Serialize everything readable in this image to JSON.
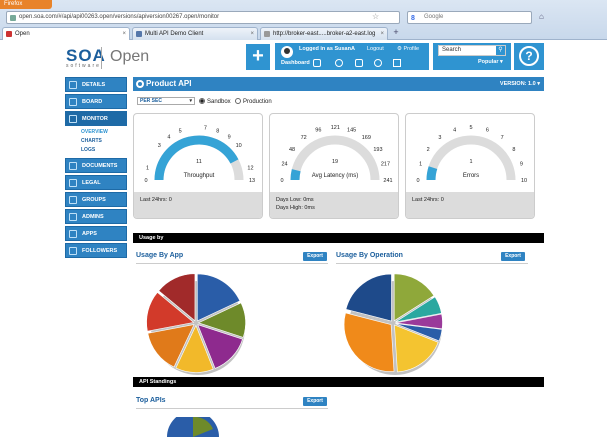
{
  "browser": {
    "menu_label": "Firefox",
    "url": "open.soa.com/#/api/api00263.open/versions/apiversion00267.open/monitor",
    "search_placeholder": "Google",
    "tabs": [
      {
        "label": "Open"
      },
      {
        "label": "Multi API Demo Client"
      },
      {
        "label": "http://broker-east.....broker-a2-east.log"
      }
    ]
  },
  "brand": {
    "name": "SOA",
    "sub": "software",
    "product": "Open"
  },
  "header": {
    "logged_in": "Logged in as SusanA",
    "logout": "Logout",
    "profile": "Profile",
    "dashboard": "Dashboard",
    "search_value": "Search",
    "popular": "Popular"
  },
  "sidebar": {
    "items": [
      {
        "label": "DETAILS"
      },
      {
        "label": "BOARD"
      },
      {
        "label": "MONITOR"
      },
      {
        "label": "DOCUMENTS"
      },
      {
        "label": "LEGAL"
      },
      {
        "label": "GROUPS"
      },
      {
        "label": "ADMINS"
      },
      {
        "label": "APPS"
      },
      {
        "label": "FOLLOWERS"
      }
    ],
    "subitems": [
      {
        "label": "OVERVIEW"
      },
      {
        "label": "CHARTS"
      },
      {
        "label": "LOGS"
      }
    ]
  },
  "product": {
    "title": "Product API",
    "version_label": "VERSION:",
    "version": "1.0"
  },
  "controls": {
    "rate_select": "PER SEC",
    "radio_sandbox": "Sandbox",
    "radio_production": "Production",
    "selected": "sandbox"
  },
  "colors": {
    "accent": "#2f94d1",
    "gauge_fill": "#35a3d6",
    "gauge_track": "#dcdcdc"
  },
  "gauges": [
    {
      "label": "Throughput",
      "value": 11,
      "min": 0,
      "max": 13,
      "ticks": [
        0,
        1,
        3,
        4,
        5,
        7,
        8,
        9,
        10,
        12,
        13
      ],
      "footer": [
        "Last 24hrs: 0"
      ]
    },
    {
      "label": "Avg Latency (ms)",
      "value": 19,
      "min": 0,
      "max": 241,
      "ticks": [
        0,
        24,
        48,
        72,
        96,
        121,
        145,
        169,
        193,
        217,
        241
      ],
      "footer": [
        "Days Low: 0ms",
        "Days High: 0ms"
      ]
    },
    {
      "label": "Errors",
      "value": 1,
      "min": 0,
      "max": 10,
      "ticks": [
        0,
        1,
        2,
        3,
        4,
        5,
        6,
        7,
        8,
        9,
        10
      ],
      "footer": [
        "Last 24hrs: 0"
      ]
    }
  ],
  "usage_section": "Usage by",
  "usage_app": {
    "title": "Usage By App",
    "export": "Export"
  },
  "usage_op": {
    "title": "Usage By Operation",
    "export": "Export"
  },
  "standings_section": "API Standings",
  "top_apis": {
    "title": "Top APIs",
    "export": "Export"
  },
  "chart_data": [
    {
      "type": "pie",
      "title": "Usage By App",
      "values": [
        18,
        12,
        14,
        13,
        15,
        14,
        14
      ],
      "colors": [
        "#2a5da8",
        "#6e8a2a",
        "#8e2a8e",
        "#f2b92a",
        "#e07a1a",
        "#d23a2a",
        "#a12a2a"
      ]
    },
    {
      "type": "pie",
      "title": "Usage By Operation",
      "values": [
        16,
        6,
        5,
        4,
        18,
        30,
        21
      ],
      "colors": [
        "#8fa83a",
        "#2ba8a0",
        "#9a3a9a",
        "#2a5da8",
        "#f4c430",
        "#f08a1a",
        "#1e4a8a"
      ]
    }
  ]
}
